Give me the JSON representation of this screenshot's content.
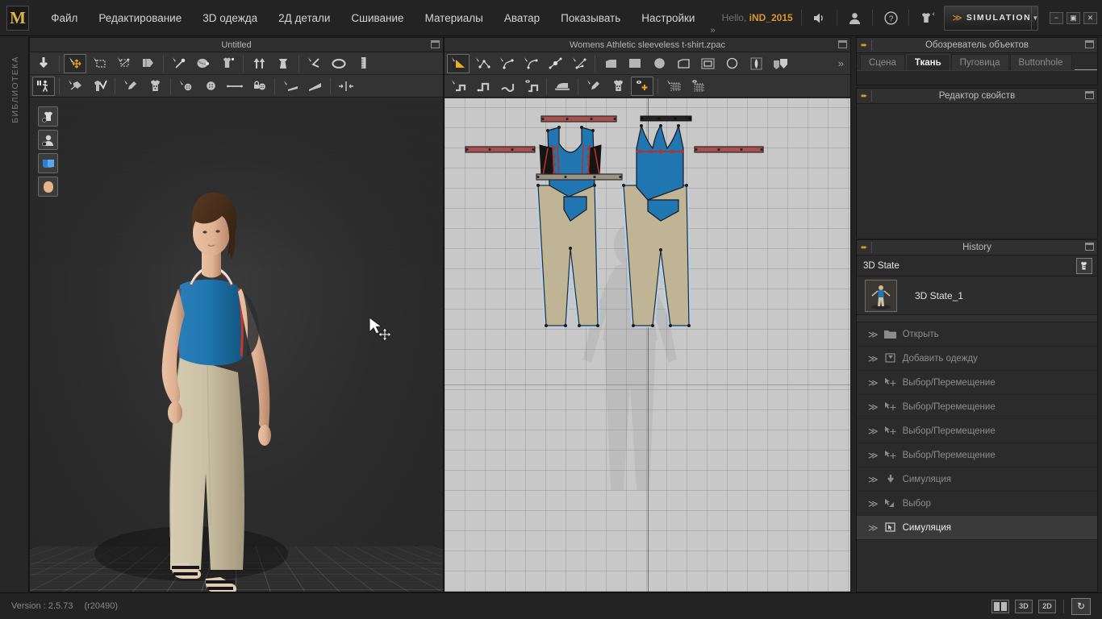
{
  "app": {
    "logo": "M",
    "greeting_prefix": "Hello,",
    "username": "iND_2015",
    "mode_label": "SIMULATION",
    "menu_overflow": "»"
  },
  "menu": {
    "items": [
      {
        "label": "Файл",
        "name": "menu-file"
      },
      {
        "label": "Редактирование",
        "name": "menu-edit"
      },
      {
        "label": "3D одежда",
        "name": "menu-3d-garment"
      },
      {
        "label": "2Д детали",
        "name": "menu-2d-pattern"
      },
      {
        "label": "Сшивание",
        "name": "menu-sewing"
      },
      {
        "label": "Материалы",
        "name": "menu-materials"
      },
      {
        "label": "Аватар",
        "name": "menu-avatar"
      },
      {
        "label": "Показывать",
        "name": "menu-display"
      },
      {
        "label": "Настройки",
        "name": "menu-settings"
      }
    ]
  },
  "window_controls": {
    "minimize": "−",
    "restore": "▣",
    "close": "✕"
  },
  "library": {
    "label": "БИБЛИОТЕКА"
  },
  "view3d": {
    "title": "Untitled",
    "overlay_icons": [
      {
        "name": "garment-visibility-icon"
      },
      {
        "name": "avatar-visibility-icon"
      },
      {
        "name": "library-book-icon"
      },
      {
        "name": "face-head-icon"
      }
    ],
    "toolbar_row1": [
      {
        "name": "sync-down-icon",
        "selected": false
      },
      {
        "name": "transform-move-icon",
        "selected": true
      },
      {
        "name": "select-box-icon",
        "selected": false
      },
      {
        "name": "select-mesh-icon",
        "selected": false
      },
      {
        "name": "fold-arrange-icon",
        "selected": false
      },
      {
        "name": "pin-tack-icon",
        "selected": false
      },
      {
        "name": "sphere-pin-icon",
        "selected": false
      },
      {
        "name": "garment-pin-icon",
        "selected": false
      },
      {
        "name": "arrange-up-icon",
        "selected": false
      },
      {
        "name": "arrange-dress-icon",
        "selected": false
      },
      {
        "name": "fold-angle-icon",
        "selected": false
      },
      {
        "name": "ring-circle-icon",
        "selected": false
      },
      {
        "name": "ruler-icon",
        "selected": false
      }
    ],
    "toolbar_row2": [
      {
        "name": "avatar-pose-icon",
        "selected": true
      },
      {
        "name": "pick-garment-icon",
        "selected": false
      },
      {
        "name": "garment-check-icon",
        "selected": false
      },
      {
        "name": "paint-brush-icon",
        "selected": false
      },
      {
        "name": "texture-shirt-icon",
        "selected": false
      },
      {
        "name": "button-place-icon",
        "selected": false
      },
      {
        "name": "button-icon",
        "selected": false
      },
      {
        "name": "zipper-line-icon",
        "selected": false
      },
      {
        "name": "lock-button-icon",
        "selected": false
      },
      {
        "name": "flatten-select-icon",
        "selected": false
      },
      {
        "name": "flatten-icon",
        "selected": false
      },
      {
        "name": "gather-tool-icon",
        "selected": false
      }
    ]
  },
  "view2d": {
    "title": "Womens Athletic sleeveless t-shirt.zpac",
    "toolbar_overflow": "»",
    "toolbar_row1": [
      {
        "name": "polygon-select-icon",
        "selected": true
      },
      {
        "name": "edit-point-icon",
        "selected": false
      },
      {
        "name": "curve-point-icon",
        "selected": false
      },
      {
        "name": "curve-edit-icon",
        "selected": false
      },
      {
        "name": "add-point-icon",
        "selected": false
      },
      {
        "name": "segment-split-icon",
        "selected": false
      },
      {
        "name": "polygon-draw-icon",
        "selected": false
      },
      {
        "name": "rectangle-draw-icon",
        "selected": false
      },
      {
        "name": "circle-fill-icon",
        "selected": false
      },
      {
        "name": "polygon-outline-icon",
        "selected": false
      },
      {
        "name": "rectangle-outline-icon",
        "selected": false
      },
      {
        "name": "circle-outline-icon",
        "selected": false
      },
      {
        "name": "dart-icon",
        "selected": false
      },
      {
        "name": "fold-shape-icon",
        "selected": false
      }
    ],
    "toolbar_row2": [
      {
        "name": "sew-segment-icon",
        "selected": false
      },
      {
        "name": "sew-free-icon",
        "selected": false
      },
      {
        "name": "sew-curve-icon",
        "selected": false
      },
      {
        "name": "sew-preview-icon",
        "selected": false
      },
      {
        "name": "iron-press-icon",
        "selected": false
      },
      {
        "name": "paint-brush-2d-icon",
        "selected": false
      },
      {
        "name": "texture-shirt-2d-icon",
        "selected": false
      },
      {
        "name": "show-move-icon",
        "selected": true
      },
      {
        "name": "mesh-select-icon",
        "selected": false
      },
      {
        "name": "mesh-preview-icon",
        "selected": false
      }
    ]
  },
  "object_browser": {
    "title": "Обозреватель объектов",
    "tabs": [
      {
        "label": "Сцена",
        "active": false
      },
      {
        "label": "Ткань",
        "active": true
      },
      {
        "label": "Пуговица",
        "active": false
      },
      {
        "label": "Buttonhole",
        "active": false
      }
    ]
  },
  "property_editor": {
    "title": "Редактор свойств"
  },
  "history": {
    "title": "History",
    "subheader": "3D State",
    "state_item": "3D State_1",
    "items": [
      {
        "label": "Открыть",
        "icon": "folder-icon",
        "active": false
      },
      {
        "label": "Добавить одежду",
        "icon": "add-garment-icon",
        "active": false
      },
      {
        "label": "Выбор/Перемещение",
        "icon": "select-move-icon",
        "active": false
      },
      {
        "label": "Выбор/Перемещение",
        "icon": "select-move-icon",
        "active": false
      },
      {
        "label": "Выбор/Перемещение",
        "icon": "select-move-icon",
        "active": false
      },
      {
        "label": "Выбор/Перемещение",
        "icon": "select-move-icon",
        "active": false
      },
      {
        "label": "Симуляция",
        "icon": "simulate-down-icon",
        "active": false
      },
      {
        "label": "Выбор",
        "icon": "select-icon",
        "active": false
      },
      {
        "label": "Симуляция",
        "icon": "simulate-cursor-icon",
        "active": true
      }
    ]
  },
  "status_bar": {
    "version": "Version : 2.5.73",
    "revision": "(r20490)",
    "buttons": [
      {
        "label": "",
        "name": "split-view-button"
      },
      {
        "label": "3D",
        "name": "view-3d-button"
      },
      {
        "label": "2D",
        "name": "view-2d-button"
      },
      {
        "label": "↻",
        "name": "refresh-button"
      }
    ]
  },
  "colors": {
    "accent": "#d79a2b",
    "garment_blue": "#1f76b0",
    "garment_tan": "#c3b89a",
    "panel_bg": "#2b2b2b",
    "canvas_2d": "#c8c8c8"
  }
}
